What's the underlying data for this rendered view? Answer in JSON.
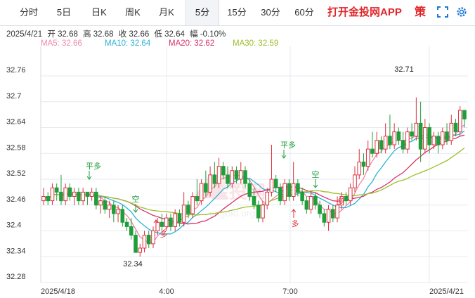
{
  "tabs": [
    {
      "label": "分时",
      "active": false
    },
    {
      "label": "5日",
      "active": false
    },
    {
      "label": "日K",
      "active": false
    },
    {
      "label": "周K",
      "active": false
    },
    {
      "label": "月K",
      "active": false
    },
    {
      "label": "5分",
      "active": true
    },
    {
      "label": "15分",
      "active": false
    },
    {
      "label": "30分",
      "active": false
    },
    {
      "label": "60分",
      "active": false
    }
  ],
  "promo": "打开金投网APP",
  "strategy": "策",
  "icons": {
    "fullscreen": "fullscreen-icon",
    "settings": "settings-gear-icon"
  },
  "info": {
    "date": "2025/4/21",
    "open_label": "开",
    "open": "32.68",
    "high_label": "高",
    "high": "32.68",
    "close_label": "收",
    "close": "32.66",
    "low_label": "低",
    "low": "32.64",
    "change_label": "幅",
    "change": "-0.10%"
  },
  "ma": [
    {
      "text": "MA5: 32.66",
      "color": "#f08aa8"
    },
    {
      "text": "MA10: 32.64",
      "color": "#2bb3d6"
    },
    {
      "text": "MA20: 32.62",
      "color": "#d8336b"
    },
    {
      "text": "MA30: 32.59",
      "color": "#9cbf2a"
    }
  ],
  "watermark": {
    "brand": "金投网",
    "domain": "cngold.org"
  },
  "colors": {
    "up": "#d9333f",
    "down": "#1f9e3a"
  },
  "chart_data": {
    "type": "candlestick",
    "interval": "5分",
    "y_ticks": [
      "32.76",
      "32.7",
      "32.64",
      "32.58",
      "32.52",
      "32.46",
      "32.4",
      "32.34",
      "32.28"
    ],
    "ylim": [
      32.28,
      32.76
    ],
    "x_labels": [
      "2025/4/18",
      "4:00",
      "7:00",
      "2025/4/21"
    ],
    "annotations": [
      {
        "text": "平多",
        "color": "#1f9e3a"
      },
      {
        "text": "空",
        "color": "#1f9e3a"
      },
      {
        "text": "多",
        "color": "#d9333f"
      },
      {
        "text": "平多",
        "color": "#1f9e3a"
      },
      {
        "text": "多",
        "color": "#d9333f"
      },
      {
        "text": "空",
        "color": "#1f9e3a"
      },
      {
        "text": "多",
        "color": "#d9333f"
      }
    ],
    "extremes": {
      "high": "32.71",
      "low": "32.34"
    },
    "candles": [
      [
        32.47,
        32.48,
        32.5,
        32.46
      ],
      [
        32.48,
        32.47,
        32.49,
        32.46
      ],
      [
        32.47,
        32.5,
        32.51,
        32.46
      ],
      [
        32.5,
        32.49,
        32.51,
        32.47
      ],
      [
        32.49,
        32.47,
        32.53,
        32.46
      ],
      [
        32.47,
        32.5,
        32.51,
        32.46
      ],
      [
        32.5,
        32.48,
        32.51,
        32.47
      ],
      [
        32.48,
        32.49,
        32.5,
        32.46
      ],
      [
        32.49,
        32.47,
        32.5,
        32.46
      ],
      [
        32.47,
        32.49,
        32.5,
        32.46
      ],
      [
        32.49,
        32.48,
        32.49,
        32.46
      ],
      [
        32.48,
        32.49,
        32.5,
        32.47
      ],
      [
        32.49,
        32.46,
        32.5,
        32.45
      ],
      [
        32.46,
        32.47,
        32.48,
        32.44
      ],
      [
        32.47,
        32.45,
        32.48,
        32.44
      ],
      [
        32.45,
        32.46,
        32.47,
        32.43
      ],
      [
        32.46,
        32.44,
        32.47,
        32.42
      ],
      [
        32.44,
        32.45,
        32.46,
        32.42
      ],
      [
        32.45,
        32.42,
        32.46,
        32.41
      ],
      [
        32.42,
        32.41,
        32.43,
        32.4
      ],
      [
        32.41,
        32.39,
        32.43,
        32.38
      ],
      [
        32.39,
        32.35,
        32.4,
        32.35
      ],
      [
        32.35,
        32.36,
        32.37,
        32.34
      ],
      [
        32.36,
        32.39,
        32.4,
        32.35
      ],
      [
        32.39,
        32.37,
        32.4,
        32.36
      ],
      [
        32.37,
        32.4,
        32.41,
        32.36
      ],
      [
        32.4,
        32.42,
        32.43,
        32.39
      ],
      [
        32.42,
        32.41,
        32.44,
        32.4
      ],
      [
        32.41,
        32.43,
        32.44,
        32.4
      ],
      [
        32.43,
        32.41,
        32.44,
        32.4
      ],
      [
        32.41,
        32.44,
        32.45,
        32.4
      ],
      [
        32.44,
        32.42,
        32.45,
        32.41
      ],
      [
        32.42,
        32.46,
        32.49,
        32.41
      ],
      [
        32.46,
        32.44,
        32.47,
        32.43
      ],
      [
        32.44,
        32.48,
        32.49,
        32.43
      ],
      [
        32.48,
        32.47,
        32.52,
        32.46
      ],
      [
        32.47,
        32.51,
        32.52,
        32.46
      ],
      [
        32.51,
        32.49,
        32.54,
        32.48
      ],
      [
        32.49,
        32.53,
        32.55,
        32.48
      ],
      [
        32.53,
        32.51,
        32.56,
        32.5
      ],
      [
        32.51,
        32.55,
        32.57,
        32.5
      ],
      [
        32.55,
        32.53,
        32.56,
        32.52
      ],
      [
        32.53,
        32.51,
        32.55,
        32.5
      ],
      [
        32.51,
        32.54,
        32.55,
        32.5
      ],
      [
        32.54,
        32.52,
        32.55,
        32.51
      ],
      [
        32.52,
        32.54,
        32.56,
        32.51
      ],
      [
        32.54,
        32.51,
        32.55,
        32.5
      ],
      [
        32.51,
        32.48,
        32.52,
        32.47
      ],
      [
        32.48,
        32.46,
        32.5,
        32.45
      ],
      [
        32.46,
        32.43,
        32.47,
        32.42
      ],
      [
        32.43,
        32.46,
        32.47,
        32.42
      ],
      [
        32.46,
        32.49,
        32.5,
        32.45
      ],
      [
        32.49,
        32.52,
        32.6,
        32.48
      ],
      [
        32.52,
        32.5,
        32.53,
        32.49
      ],
      [
        32.5,
        32.47,
        32.51,
        32.46
      ],
      [
        32.47,
        32.51,
        32.52,
        32.46
      ],
      [
        32.51,
        32.48,
        32.52,
        32.47
      ],
      [
        32.48,
        32.51,
        32.56,
        32.47
      ],
      [
        32.51,
        32.49,
        32.52,
        32.48
      ],
      [
        32.49,
        32.47,
        32.5,
        32.46
      ],
      [
        32.47,
        32.45,
        32.48,
        32.44
      ],
      [
        32.45,
        32.48,
        32.49,
        32.44
      ],
      [
        32.48,
        32.46,
        32.49,
        32.45
      ],
      [
        32.46,
        32.44,
        32.47,
        32.43
      ],
      [
        32.44,
        32.42,
        32.45,
        32.41
      ],
      [
        32.42,
        32.45,
        32.46,
        32.4
      ],
      [
        32.45,
        32.43,
        32.46,
        32.42
      ],
      [
        32.43,
        32.46,
        32.48,
        32.42
      ],
      [
        32.46,
        32.48,
        32.49,
        32.45
      ],
      [
        32.48,
        32.47,
        32.49,
        32.46
      ],
      [
        32.47,
        32.5,
        32.51,
        32.46
      ],
      [
        32.5,
        32.53,
        32.55,
        32.49
      ],
      [
        32.53,
        32.56,
        32.59,
        32.52
      ],
      [
        32.56,
        32.55,
        32.58,
        32.53
      ],
      [
        32.55,
        32.59,
        32.61,
        32.54
      ],
      [
        32.59,
        32.58,
        32.63,
        32.57
      ],
      [
        32.58,
        32.61,
        32.63,
        32.57
      ],
      [
        32.61,
        32.59,
        32.62,
        32.58
      ],
      [
        32.59,
        32.62,
        32.65,
        32.58
      ],
      [
        32.62,
        32.6,
        32.67,
        32.59
      ],
      [
        32.6,
        32.63,
        32.65,
        32.59
      ],
      [
        32.63,
        32.61,
        32.64,
        32.6
      ],
      [
        32.61,
        32.59,
        32.63,
        32.58
      ],
      [
        32.59,
        32.63,
        32.64,
        32.58
      ],
      [
        32.63,
        32.62,
        32.65,
        32.61
      ],
      [
        32.62,
        32.65,
        32.71,
        32.61
      ],
      [
        32.65,
        32.59,
        32.7,
        32.56
      ],
      [
        32.59,
        32.64,
        32.66,
        32.58
      ],
      [
        32.64,
        32.6,
        32.65,
        32.58
      ],
      [
        32.6,
        32.62,
        32.63,
        32.59
      ],
      [
        32.62,
        32.6,
        32.63,
        32.58
      ],
      [
        32.6,
        32.63,
        32.64,
        32.59
      ],
      [
        32.63,
        32.61,
        32.65,
        32.6
      ],
      [
        32.61,
        32.65,
        32.67,
        32.6
      ],
      [
        32.65,
        32.63,
        32.66,
        32.62
      ],
      [
        32.63,
        32.68,
        32.69,
        32.62
      ],
      [
        32.68,
        32.66,
        32.68,
        32.64
      ]
    ]
  }
}
